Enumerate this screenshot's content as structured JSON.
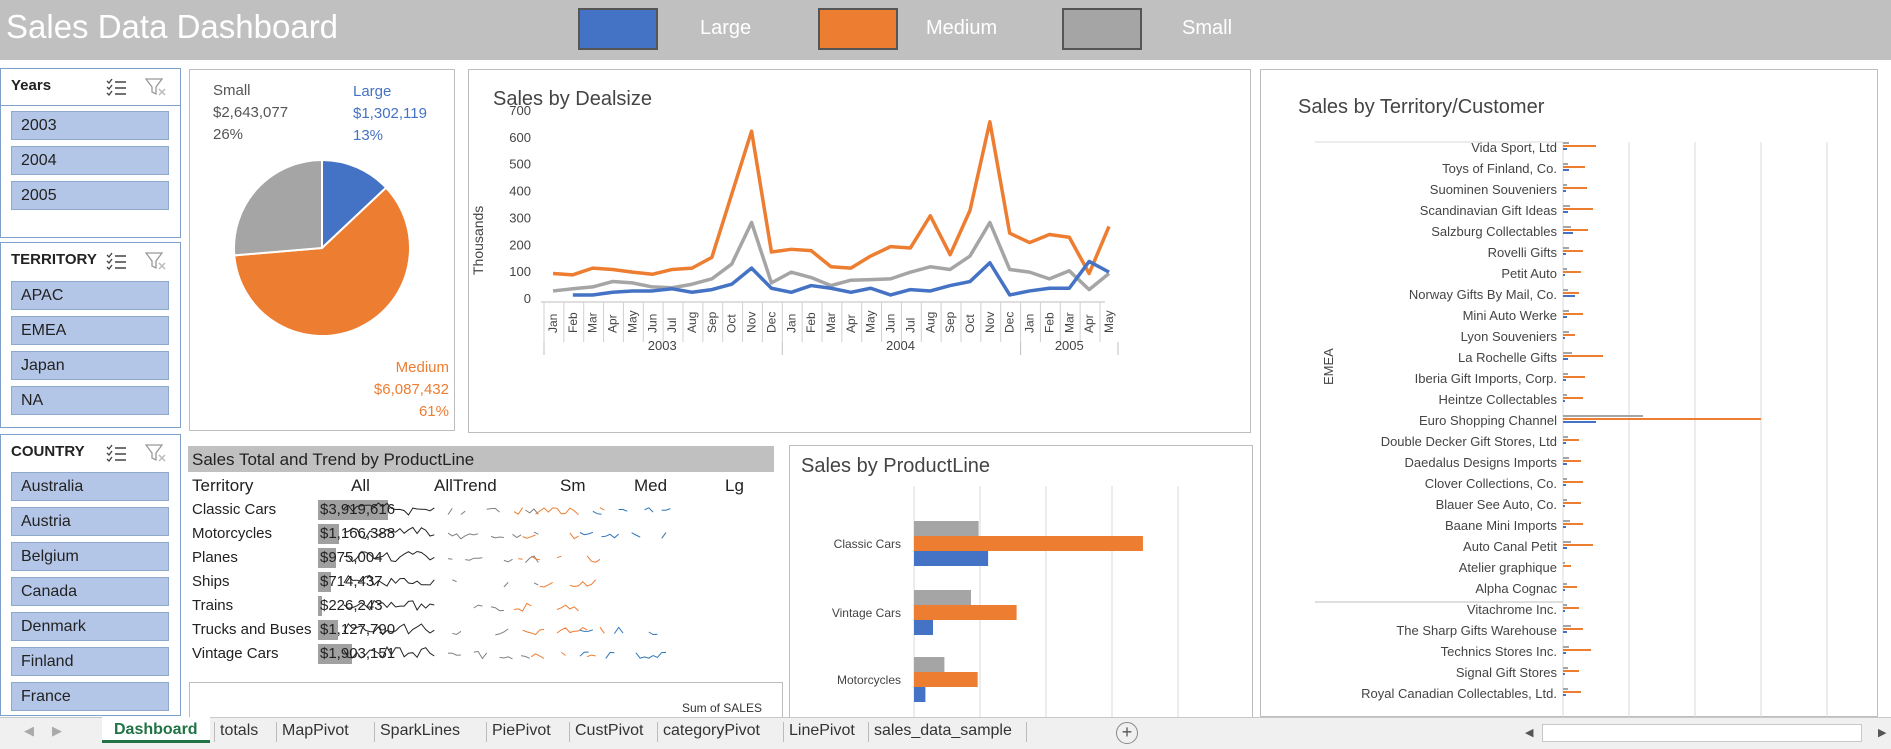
{
  "header": {
    "title": "Sales Data Dashboard",
    "legend": [
      {
        "label": "Large",
        "color": "#4472c4"
      },
      {
        "label": "Medium",
        "color": "#ed7d31"
      },
      {
        "label": "Small",
        "color": "#a5a5a5"
      }
    ]
  },
  "slicers": {
    "years": {
      "title": "Years",
      "items": [
        "2003",
        "2004",
        "2005"
      ]
    },
    "territory": {
      "title": "TERRITORY",
      "items": [
        "APAC",
        "EMEA",
        "Japan",
        "NA"
      ]
    },
    "country": {
      "title": "COUNTRY",
      "items": [
        "Australia",
        "Austria",
        "Belgium",
        "Canada",
        "Denmark",
        "Finland",
        "France"
      ]
    }
  },
  "pie": {
    "small": {
      "label": "Small",
      "value": "$2,643,077",
      "pct": "26%"
    },
    "large": {
      "label": "Large",
      "value": "$1,302,119",
      "pct": "13%"
    },
    "medium": {
      "label": "Medium",
      "value": "$6,087,432",
      "pct": "61%"
    }
  },
  "chart_data": [
    {
      "type": "pie",
      "categories": [
        "Large",
        "Medium",
        "Small"
      ],
      "values": [
        1302119,
        6087432,
        2643077
      ],
      "colors": [
        "#4472c4",
        "#ed7d31",
        "#a5a5a5"
      ]
    },
    {
      "type": "line",
      "title": "Sales by Dealsize",
      "ylabel": "Thousands",
      "ylim": [
        0,
        700
      ],
      "yticks": [
        "700",
        "600",
        "500",
        "400",
        "300",
        "200",
        "100",
        "0"
      ],
      "x": [
        "Jan",
        "Feb",
        "Mar",
        "Apr",
        "May",
        "Jun",
        "Jul",
        "Aug",
        "Sep",
        "Oct",
        "Nov",
        "Dec",
        "Jan",
        "Feb",
        "Mar",
        "Apr",
        "May",
        "Jun",
        "Jul",
        "Aug",
        "Sep",
        "Oct",
        "Nov",
        "Dec",
        "Jan",
        "Feb",
        "Mar",
        "Apr",
        "May"
      ],
      "year_groups": [
        {
          "label": "2003",
          "count": 12
        },
        {
          "label": "2004",
          "count": 12
        },
        {
          "label": "2005",
          "count": 5
        }
      ],
      "grid": false,
      "series": [
        {
          "name": "Medium",
          "color": "#ed7d31",
          "values": [
            95,
            90,
            115,
            110,
            100,
            92,
            110,
            115,
            155,
            390,
            625,
            175,
            185,
            180,
            120,
            115,
            160,
            195,
            190,
            310,
            165,
            330,
            660,
            245,
            210,
            240,
            230,
            95,
            270
          ]
        },
        {
          "name": "Small",
          "color": "#a5a5a5",
          "values": [
            30,
            38,
            45,
            65,
            60,
            45,
            42,
            55,
            75,
            130,
            285,
            60,
            100,
            80,
            50,
            70,
            72,
            75,
            100,
            120,
            110,
            160,
            285,
            110,
            100,
            75,
            105,
            35,
            95
          ]
        },
        {
          "name": "Large",
          "color": "#4472c4",
          "values": [
            null,
            15,
            15,
            25,
            30,
            30,
            38,
            25,
            35,
            55,
            115,
            40,
            25,
            50,
            40,
            25,
            40,
            15,
            35,
            30,
            50,
            65,
            135,
            15,
            30,
            40,
            40,
            140,
            100
          ]
        }
      ]
    },
    {
      "type": "bar",
      "title": "Sales by ProductLine",
      "categories": [
        "Classic Cars",
        "Vintage Cars",
        "Motorcycles"
      ],
      "series": [
        {
          "name": "Small",
          "color": "#a5a5a5",
          "values": 68
        },
        {
          "name": "Medium",
          "color": "#ed7d31",
          "values": 241
        },
        {
          "name": "Large",
          "color": "#4472c4",
          "values": 78
        }
      ],
      "bars": [
        {
          "category": "Classic Cars",
          "small": 68,
          "medium": 241,
          "large": 78
        },
        {
          "category": "Vintage Cars",
          "small": 60,
          "medium": 108,
          "large": 20
        },
        {
          "category": "Motorcycles",
          "small": 32,
          "medium": 67,
          "large": 12
        }
      ],
      "grid": true
    },
    {
      "type": "bar",
      "title": "Sales by Territory/Customer",
      "group_label": "EMEA",
      "categories": [
        "Vida Sport, Ltd",
        "Toys of Finland, Co.",
        "Suominen Souveniers",
        "Scandinavian Gift Ideas",
        "Salzburg Collectables",
        "Rovelli Gifts",
        "Petit Auto",
        "Norway Gifts By Mail, Co.",
        "Mini Auto Werke",
        "Lyon Souveniers",
        "La Rochelle Gifts",
        "Iberia Gift Imports, Corp.",
        "Heintze Collectables",
        "Euro Shopping Channel",
        "Double Decker Gift Stores, Ltd",
        "Daedalus Designs Imports",
        "Clover Collections, Co.",
        "Blauer See Auto, Co.",
        "Baane Mini Imports",
        "Auto Canal Petit",
        "Atelier graphique",
        "Alpha Cognac",
        "Vitachrome Inc.",
        "The Sharp Gifts Warehouse",
        "Technics Stores Inc.",
        "Signal Gift Stores",
        "Royal Canadian Collectables, Ltd."
      ],
      "series": [
        {
          "name": "Small",
          "color": "#a5a5a5",
          "values": [
            6,
            5,
            4,
            7,
            8,
            6,
            4,
            5,
            6,
            6,
            9,
            5,
            4,
            80,
            5,
            6,
            4,
            4,
            7,
            8,
            2,
            4,
            4,
            8,
            6,
            5,
            5
          ]
        },
        {
          "name": "Medium",
          "color": "#ed7d31",
          "values": [
            33,
            22,
            24,
            30,
            25,
            20,
            18,
            16,
            20,
            12,
            40,
            22,
            20,
            198,
            16,
            18,
            20,
            18,
            20,
            30,
            8,
            14,
            16,
            20,
            28,
            16,
            18
          ]
        },
        {
          "name": "Large",
          "color": "#4472c4",
          "values": [
            4,
            6,
            3,
            5,
            10,
            3,
            2,
            12,
            4,
            2,
            5,
            3,
            2,
            33,
            3,
            4,
            3,
            2,
            3,
            4,
            0,
            2,
            2,
            4,
            3,
            2,
            3
          ]
        }
      ],
      "grid": true
    }
  ],
  "sparkline_table": {
    "title": "Sales Total and Trend by ProductLine",
    "columns": [
      "Territory",
      "All",
      "AllTrend",
      "Sm",
      "Med",
      "Lg"
    ],
    "rows": [
      {
        "name": "Classic Cars",
        "total": "$3,919,616",
        "share": 1.0
      },
      {
        "name": "Motorcycles",
        "total": "$1,166,388",
        "share": 0.3
      },
      {
        "name": "Planes",
        "total": "$975,004",
        "share": 0.25
      },
      {
        "name": "Ships",
        "total": "$714,437",
        "share": 0.18
      },
      {
        "name": "Trains",
        "total": "$226,243",
        "share": 0.06
      },
      {
        "name": "Trucks and Buses",
        "total": "$1,127,790",
        "share": 0.29
      },
      {
        "name": "Vintage Cars",
        "total": "$1,903,151",
        "share": 0.49
      }
    ],
    "sparkline_colors": {
      "all": "#222222",
      "sm": "#808080",
      "med": "#ed7d31",
      "lg": "#2e75b6"
    }
  },
  "lower_chart": {
    "label": "Sum of SALES"
  },
  "tabs": [
    "Dashboard",
    "totals",
    "MapPivot",
    "SparkLines",
    "PiePivot",
    "CustPivot",
    "categoryPivot",
    "LinePivot",
    "sales_data_sample"
  ],
  "active_tab": "Dashboard"
}
